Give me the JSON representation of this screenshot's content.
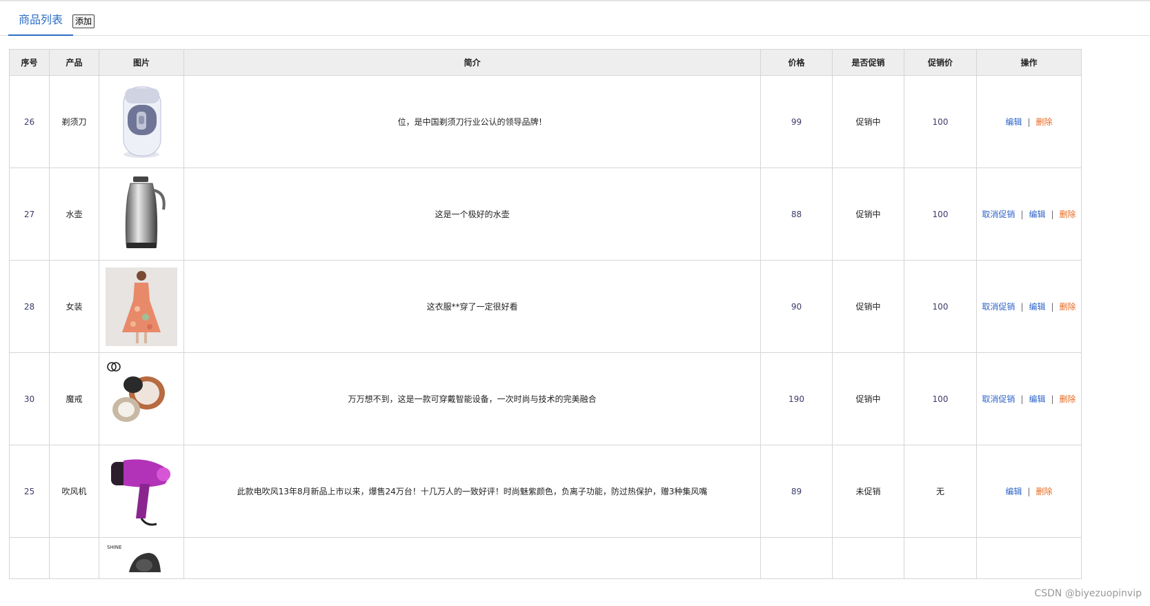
{
  "tabs": {
    "active": "商品列表",
    "add_button": "添加"
  },
  "table": {
    "headers": [
      "序号",
      "产品",
      "图片",
      "简介",
      "价格",
      "是否促销",
      "促销价",
      "操作"
    ],
    "rows": [
      {
        "id": "26",
        "name": "剃须刀",
        "image": "shaver-image",
        "desc": "位，是中国剃须刀行业公认的领导品牌！",
        "price": "99",
        "promo": "促销中",
        "promo_price": "100",
        "actions": [
          "编辑",
          "删除"
        ]
      },
      {
        "id": "27",
        "name": "水壶",
        "image": "kettle-image",
        "desc": "这是一个极好的水壶",
        "price": "88",
        "promo": "促销中",
        "promo_price": "100",
        "actions": [
          "取消促销",
          "编辑",
          "删除"
        ]
      },
      {
        "id": "28",
        "name": "女装",
        "image": "dress-image",
        "desc": "这衣服**穿了一定很好看",
        "price": "90",
        "promo": "促销中",
        "promo_price": "100",
        "actions": [
          "取消促销",
          "编辑",
          "删除"
        ]
      },
      {
        "id": "30",
        "name": "魔戒",
        "image": "ring-image",
        "desc": "万万想不到，这是一款可穿戴智能设备，一次时尚与技术的完美融合",
        "price": "190",
        "promo": "促销中",
        "promo_price": "100",
        "actions": [
          "取消促销",
          "编辑",
          "删除"
        ]
      },
      {
        "id": "25",
        "name": "吹风机",
        "image": "hairdryer-image",
        "desc": "此款电吹风13年8月新品上市以来，爆售24万台！十几万人的一致好评！时尚魅紫颜色，负离子功能，防过热保护，赠3种集风嘴",
        "price": "89",
        "promo": "未促销",
        "promo_price": "无",
        "actions": [
          "编辑",
          "删除"
        ]
      }
    ],
    "partial_row_image_text": "SHINE"
  },
  "watermark": "CSDN @biyezuopinvip"
}
